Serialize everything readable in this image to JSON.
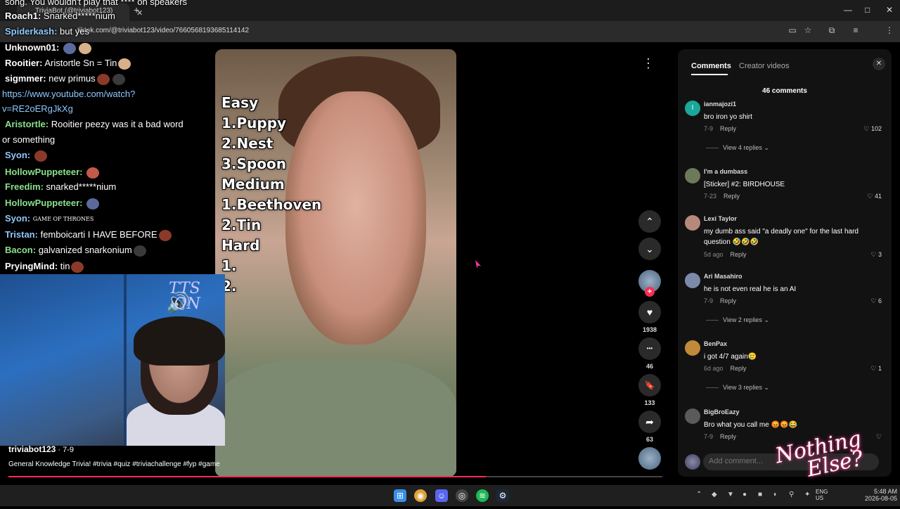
{
  "browser": {
    "tab_title": "TriviaBot (@triviabot123)",
    "tab_close": "✕",
    "new_tab": "+",
    "url": "tiktok.com/@triviabot123/video/7660568193685114142",
    "min": "—",
    "max": "□",
    "close": "✕"
  },
  "chat": {
    "lines": [
      {
        "user": "",
        "text": "song. You wouldn't play that **** on speakers",
        "user_color": "#ffffff"
      },
      {
        "user": "Roach1:",
        "text": "Snarked*****nium",
        "user_color": "#ffffff"
      },
      {
        "user": "Spiderkash:",
        "text": "but yes",
        "user_color": "#8ec8ff"
      },
      {
        "user": "Unknown01:",
        "text": "",
        "user_color": "#ffffff"
      },
      {
        "user": "Rooitier:",
        "text": "Aristortle Sn = Tin",
        "user_color": "#ffffff"
      },
      {
        "user": "sigmmer:",
        "text": "new primus",
        "user_color": "#ffffff"
      },
      {
        "user": "",
        "text": "https://www.youtube.com/watch?",
        "user_color": "#8ec8ff"
      },
      {
        "user": "",
        "text": "v=RE2oERgJkXg",
        "user_color": "#8ec8ff"
      },
      {
        "user": "Aristortle:",
        "text": "Rooitier peezy was it a bad word",
        "user_color": "#8be08b"
      },
      {
        "user": "",
        "text": "or something",
        "user_color": "#ffffff"
      },
      {
        "user": "Syon:",
        "text": "",
        "user_color": "#8ec8ff"
      },
      {
        "user": "HollowPuppeteer:",
        "text": "",
        "user_color": "#8be08b"
      },
      {
        "user": "Freedim:",
        "text": "snarked*****nium",
        "user_color": "#8be08b"
      },
      {
        "user": "HollowPuppeteer:",
        "text": "",
        "user_color": "#8be08b"
      },
      {
        "user": "Syon:",
        "text": "",
        "user_color": "#8ec8ff"
      },
      {
        "user": "Tristan:",
        "text": "femboicarti I HAVE BEFORE",
        "user_color": "#8ec8ff"
      },
      {
        "user": "Bacon:",
        "text": "galvanized snarkonium",
        "user_color": "#8be08b"
      },
      {
        "user": "PryingMind:",
        "text": "tin",
        "user_color": "#ffffff"
      }
    ],
    "emote_got": "GAME OF THRONES"
  },
  "webcam": {
    "tts_line1": "TTS",
    "tts_line2": "ON",
    "speaker": "🔊"
  },
  "video": {
    "trivia_lines": [
      "Easy",
      "1.Puppy",
      "2.Nest",
      "3.Spoon",
      "Medium",
      "1.Beethoven",
      "2.Tin",
      "Hard",
      "1.",
      "2."
    ],
    "progress": 0.73,
    "author": "triviabot123",
    "date": " · 7-9",
    "caption": "General Knowledge Trivia! #trivia #quiz #triviachallenge #fyp #game"
  },
  "actions": {
    "more": "⋮",
    "up": "⌃",
    "down": "⌄",
    "follow": "+",
    "like_icon": "♥",
    "like_count": "1938",
    "comment_icon": "•••",
    "comment_count": "46",
    "save_icon": "🔖",
    "save_count": "133",
    "share_icon": "➦",
    "share_count": "63"
  },
  "panel": {
    "tab_comments": "Comments",
    "tab_creator": "Creator videos",
    "close": "✕",
    "count": "46 comments",
    "reply": "Reply",
    "add_placeholder": "Add comment...",
    "comments": [
      {
        "name": "ianmajozi1",
        "text": "bro iron yo shirt",
        "date": "7-9",
        "likes": "102",
        "avatar_color": "#1aa89a",
        "initial": "I",
        "replies": "View 4 replies"
      },
      {
        "name": "I'm a dumbass",
        "text": "[Sticker] #2: BIRDHOUSE",
        "date": "7-23",
        "likes": "41",
        "avatar_color": "#6c7a5a",
        "initial": "",
        "replies": ""
      },
      {
        "name": "Lexi Taylor",
        "text": "my dumb ass said \"a deadly one\" for the last hard question 🤣🤣🤣",
        "date": "5d ago",
        "likes": "3",
        "avatar_color": "#b58a7a",
        "initial": "",
        "replies": ""
      },
      {
        "name": "Ari Masahiro",
        "text": "he is not even real he is an AI",
        "date": "7-9",
        "likes": "6",
        "avatar_color": "#7a8aa8",
        "initial": "",
        "replies": "View 2 replies"
      },
      {
        "name": "BenPax",
        "text": "i got 4/7 again🥲",
        "date": "6d ago",
        "likes": "1",
        "avatar_color": "#c08a3a",
        "initial": "",
        "replies": "View 3 replies"
      },
      {
        "name": "BigBroEazy",
        "text": "Bro what you call me 😡😡😂",
        "date": "7-9",
        "likes": "",
        "avatar_color": "#5a5a5a",
        "initial": "",
        "replies": ""
      }
    ]
  },
  "watermark": {
    "line1": "Nothing",
    "line2": "Else?"
  },
  "taskbar": {
    "lang1": "ENG",
    "lang2": "US",
    "time": "5:48 AM",
    "date": "2026-08-05"
  },
  "colors": {
    "accent": "#fe2c55",
    "panel_bg": "#121212"
  }
}
